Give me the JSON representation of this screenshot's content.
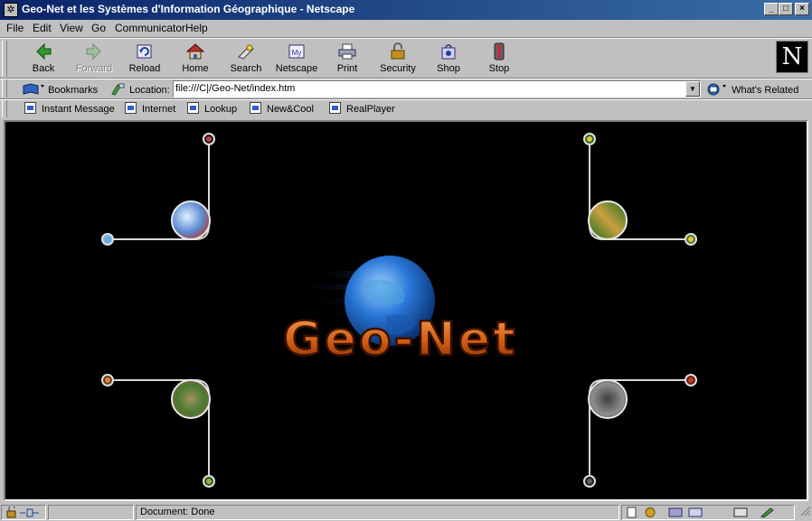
{
  "window": {
    "title": "Geo-Net et les Systèmes d'Information Géographique - Netscape",
    "controls": [
      "_",
      "□",
      "×"
    ]
  },
  "menu": [
    "File",
    "Edit",
    "View",
    "Go",
    "Communicator",
    "Help"
  ],
  "navigation_toolbar": [
    {
      "label": "Back",
      "icon": "back-arrow-icon",
      "enabled": true
    },
    {
      "label": "Forward",
      "icon": "forward-arrow-icon",
      "enabled": false
    },
    {
      "label": "Reload",
      "icon": "reload-icon",
      "enabled": true
    },
    {
      "label": "Home",
      "icon": "home-icon",
      "enabled": true
    },
    {
      "label": "Search",
      "icon": "search-icon",
      "enabled": true
    },
    {
      "label": "Netscape",
      "icon": "netscape-my-icon",
      "enabled": true
    },
    {
      "label": "Print",
      "icon": "printer-icon",
      "enabled": true
    },
    {
      "label": "Security",
      "icon": "padlock-icon",
      "enabled": true
    },
    {
      "label": "Shop",
      "icon": "shopping-bag-icon",
      "enabled": true
    },
    {
      "label": "Stop",
      "icon": "stop-icon",
      "enabled": true
    }
  ],
  "location_bar": {
    "bookmarks_label": "Bookmarks",
    "location_label": "Location:",
    "url": "file:///C|/Geo-Net/index.htm",
    "whats_related_label": "What's Related"
  },
  "personal_toolbar": [
    "Instant Message",
    "Internet",
    "Lookup",
    "New&Cool",
    "RealPlayer"
  ],
  "page": {
    "logo_text": "Geo-Net",
    "background_color": "#000000",
    "nav_nodes": [
      {
        "corner": "top-left",
        "thumb": "map-thumbnail"
      },
      {
        "corner": "top-right",
        "thumb": "terrain-thumbnail"
      },
      {
        "corner": "bottom-left",
        "thumb": "city-aerial-thumbnail"
      },
      {
        "corner": "bottom-right",
        "thumb": "device-thumbnail"
      }
    ]
  },
  "status": {
    "text": "Document: Done"
  },
  "colors": {
    "titlebar_start": "#0a246a",
    "titlebar_end": "#3a6ea5",
    "chrome": "#c0c0c0",
    "logo_orange": "#e06a1c"
  }
}
